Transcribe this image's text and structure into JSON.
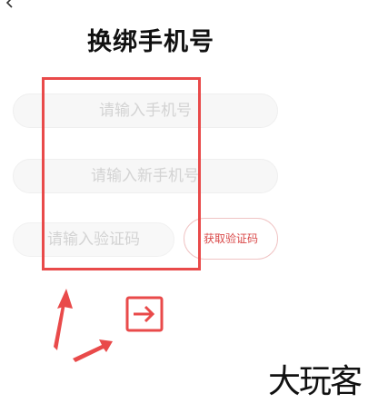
{
  "header": {
    "title": "换绑手机号",
    "back_icon": "chevron-left-icon"
  },
  "form": {
    "phone": {
      "placeholder": "请输入手机号"
    },
    "new_phone": {
      "placeholder": "请输入新手机号"
    },
    "code": {
      "placeholder": "请输入验证码"
    },
    "get_code_label": "获取验证码"
  },
  "overlay": {
    "watermark": "大玩客",
    "highlight_color": "#e94a4a",
    "icon": "arrow-right-box-icon"
  },
  "colors": {
    "accent": "#d94848",
    "placeholder": "#d3d3d3",
    "field_bg": "#f7f7f7"
  }
}
